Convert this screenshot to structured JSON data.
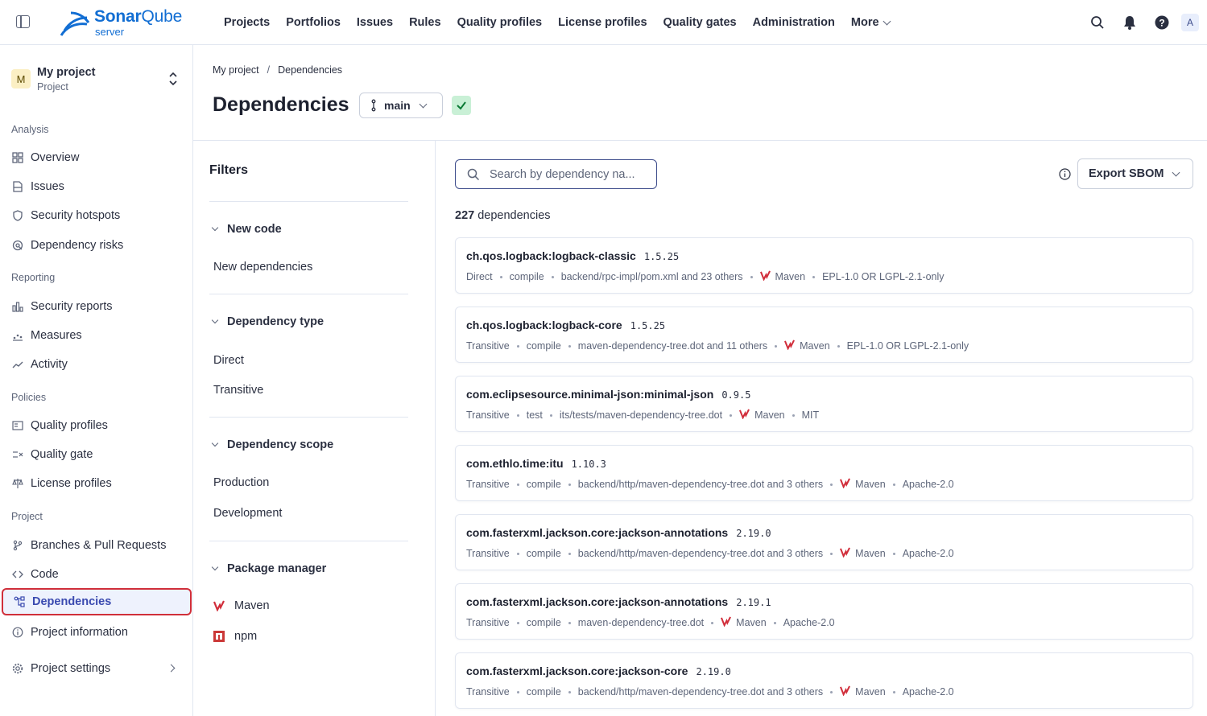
{
  "app": {
    "logo_name_part1": "Sonar",
    "logo_name_part2": "Qube",
    "logo_sub": "server"
  },
  "topnav": {
    "items": [
      "Projects",
      "Portfolios",
      "Issues",
      "Rules",
      "Quality profiles",
      "License profiles",
      "Quality gates",
      "Administration"
    ],
    "more_label": "More",
    "avatar_letter": "A"
  },
  "project": {
    "avatar_letter": "M",
    "name": "My project",
    "type": "Project"
  },
  "sidebar": {
    "sections": {
      "analysis": "Analysis",
      "reporting": "Reporting",
      "policies": "Policies",
      "project": "Project"
    },
    "items": {
      "overview": "Overview",
      "issues": "Issues",
      "security_hotspots": "Security hotspots",
      "dependency_risks": "Dependency risks",
      "security_reports": "Security reports",
      "measures": "Measures",
      "activity": "Activity",
      "quality_profiles": "Quality profiles",
      "quality_gate": "Quality gate",
      "license_profiles": "License profiles",
      "branches": "Branches & Pull Requests",
      "code": "Code",
      "dependencies": "Dependencies",
      "project_information": "Project information",
      "project_settings": "Project settings"
    },
    "active_item": "dependencies"
  },
  "header": {
    "breadcrumb": [
      "My project",
      "Dependencies"
    ],
    "breadcrumb_sep": "/",
    "title": "Dependencies",
    "branch": "main"
  },
  "filters": {
    "title": "Filters",
    "new_code": {
      "label": "New code",
      "options": [
        "New dependencies"
      ]
    },
    "dependency_type": {
      "label": "Dependency type",
      "options": [
        "Direct",
        "Transitive"
      ]
    },
    "dependency_scope": {
      "label": "Dependency scope",
      "options": [
        "Production",
        "Development"
      ]
    },
    "package_manager": {
      "label": "Package manager",
      "options": [
        "Maven",
        "npm"
      ]
    }
  },
  "results": {
    "search_placeholder": "Search by dependency na...",
    "export_label": "Export SBOM",
    "count_number": "227",
    "count_suffix": " dependencies",
    "dependencies": [
      {
        "name": "ch.qos.logback:logback-classic",
        "version": "1.5.25",
        "type": "Direct",
        "scope": "compile",
        "file": "backend/rpc-impl/pom.xml and 23 others",
        "manager": "Maven",
        "license": "EPL-1.0 OR LGPL-2.1-only"
      },
      {
        "name": "ch.qos.logback:logback-core",
        "version": "1.5.25",
        "type": "Transitive",
        "scope": "compile",
        "file": "maven-dependency-tree.dot and 11 others",
        "manager": "Maven",
        "license": "EPL-1.0 OR LGPL-2.1-only"
      },
      {
        "name": "com.eclipsesource.minimal-json:minimal-json",
        "version": "0.9.5",
        "type": "Transitive",
        "scope": "test",
        "file": "its/tests/maven-dependency-tree.dot",
        "manager": "Maven",
        "license": "MIT"
      },
      {
        "name": "com.ethlo.time:itu",
        "version": "1.10.3",
        "type": "Transitive",
        "scope": "compile",
        "file": "backend/http/maven-dependency-tree.dot and 3 others",
        "manager": "Maven",
        "license": "Apache-2.0"
      },
      {
        "name": "com.fasterxml.jackson.core:jackson-annotations",
        "version": "2.19.0",
        "type": "Transitive",
        "scope": "compile",
        "file": "backend/http/maven-dependency-tree.dot and 3 others",
        "manager": "Maven",
        "license": "Apache-2.0"
      },
      {
        "name": "com.fasterxml.jackson.core:jackson-annotations",
        "version": "2.19.1",
        "type": "Transitive",
        "scope": "compile",
        "file": "maven-dependency-tree.dot",
        "manager": "Maven",
        "license": "Apache-2.0"
      },
      {
        "name": "com.fasterxml.jackson.core:jackson-core",
        "version": "2.19.0",
        "type": "Transitive",
        "scope": "compile",
        "file": "backend/http/maven-dependency-tree.dot and 3 others",
        "manager": "Maven",
        "license": "Apache-2.0"
      }
    ]
  },
  "colors": {
    "accent": "#3e4d8c",
    "brand": "#126ed3",
    "maven": "#d12e3b",
    "active_outline": "#d02f3a",
    "quality_gate_ok": "#c9f0d6"
  },
  "icons": [
    "sidebar-toggle-icon",
    "search-icon",
    "bell-icon",
    "help-icon",
    "branch-icon",
    "check-icon",
    "info-icon",
    "chevron-down-icon",
    "maven-icon",
    "npm-icon"
  ]
}
